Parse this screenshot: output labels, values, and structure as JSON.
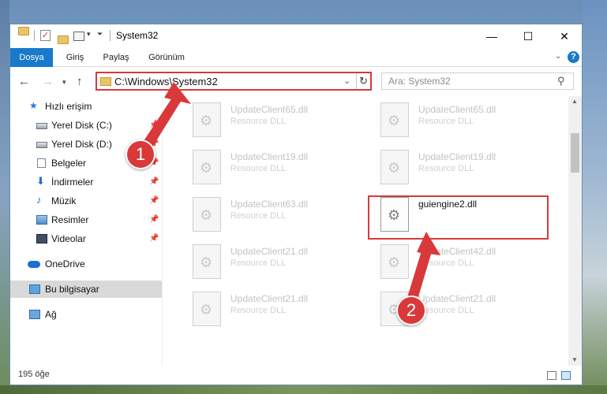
{
  "window": {
    "title": "System32",
    "controls": {
      "minimize": "—",
      "maximize": "☐",
      "close": "✕"
    }
  },
  "ribbon": {
    "tabs": [
      "Dosya",
      "Giriş",
      "Paylaş",
      "Görünüm"
    ],
    "help_icon": "?"
  },
  "address_bar": {
    "path": "C:\\Windows\\System32",
    "search_placeholder": "Ara: System32"
  },
  "nav_pane": {
    "items": [
      {
        "label": "Hızlı erişim",
        "icon": "star-icon"
      },
      {
        "label": "Yerel Disk (C:)",
        "icon": "drive-icon",
        "pinned": true
      },
      {
        "label": "Yerel Disk (D:)",
        "icon": "drive-icon",
        "pinned": true
      },
      {
        "label": "Belgeler",
        "icon": "document-icon",
        "pinned": true
      },
      {
        "label": "İndirmeler",
        "icon": "download-icon",
        "pinned": true
      },
      {
        "label": "Müzik",
        "icon": "music-icon",
        "pinned": true
      },
      {
        "label": "Resimler",
        "icon": "pictures-icon",
        "pinned": true
      },
      {
        "label": "Videolar",
        "icon": "video-icon",
        "pinned": true
      },
      {
        "label": "OneDrive",
        "icon": "cloud-icon"
      },
      {
        "label": "Bu bilgisayar",
        "icon": "computer-icon",
        "selected": true
      },
      {
        "label": "Ağ",
        "icon": "network-icon"
      }
    ]
  },
  "files": [
    {
      "name": "UpdateClient65.dll",
      "type": "Resource DLL"
    },
    {
      "name": "UpdateClient65.dll",
      "type": "Resource DLL"
    },
    {
      "name": "UpdateClient19.dll",
      "type": "Resource DLL"
    },
    {
      "name": "UpdateClient19.dll",
      "type": "Resource DLL"
    },
    {
      "name": "UpdateClient63.dll",
      "type": "Resource DLL"
    },
    {
      "name": "guiengine2.dll",
      "type": "",
      "highlighted": true
    },
    {
      "name": "UpdateClient21.dll",
      "type": "Resource DLL"
    },
    {
      "name": "UpdateClient42.dll",
      "type": "Resource DLL"
    },
    {
      "name": "UpdateClient21.dll",
      "type": "Resource DLL"
    },
    {
      "name": "UpdateClient21.dll",
      "type": "Resource DLL"
    }
  ],
  "status": {
    "item_count": "195 öğe"
  },
  "annotations": {
    "step1": "1",
    "step2": "2",
    "accent": "#d9393a"
  }
}
